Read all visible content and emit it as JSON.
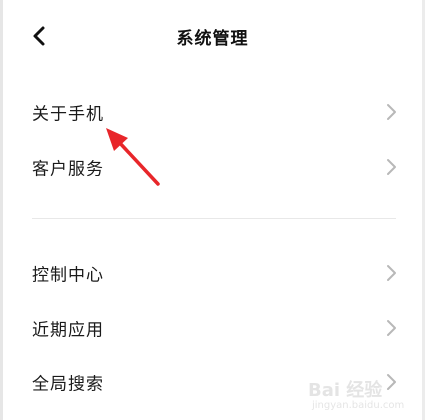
{
  "header": {
    "title": "系统管理",
    "back_icon": "chevron-left-icon"
  },
  "menu": {
    "group1": [
      {
        "label": "关于手机",
        "icon": "chevron-right-icon"
      },
      {
        "label": "客户服务",
        "icon": "chevron-right-icon"
      }
    ],
    "group2": [
      {
        "label": "控制中心",
        "icon": "chevron-right-icon"
      },
      {
        "label": "近期应用",
        "icon": "chevron-right-icon"
      },
      {
        "label": "全局搜索",
        "icon": "chevron-right-icon"
      }
    ]
  },
  "annotation": {
    "arrow_color": "#e8262a",
    "target": "关于手机"
  },
  "watermark": {
    "text": "Bai 经验",
    "sub": "jingyan.baidu.com"
  },
  "colors": {
    "background": "#ffffff",
    "text": "#1a1a1a",
    "chevron": "#b8b8b8",
    "divider": "#e8e8e8"
  }
}
